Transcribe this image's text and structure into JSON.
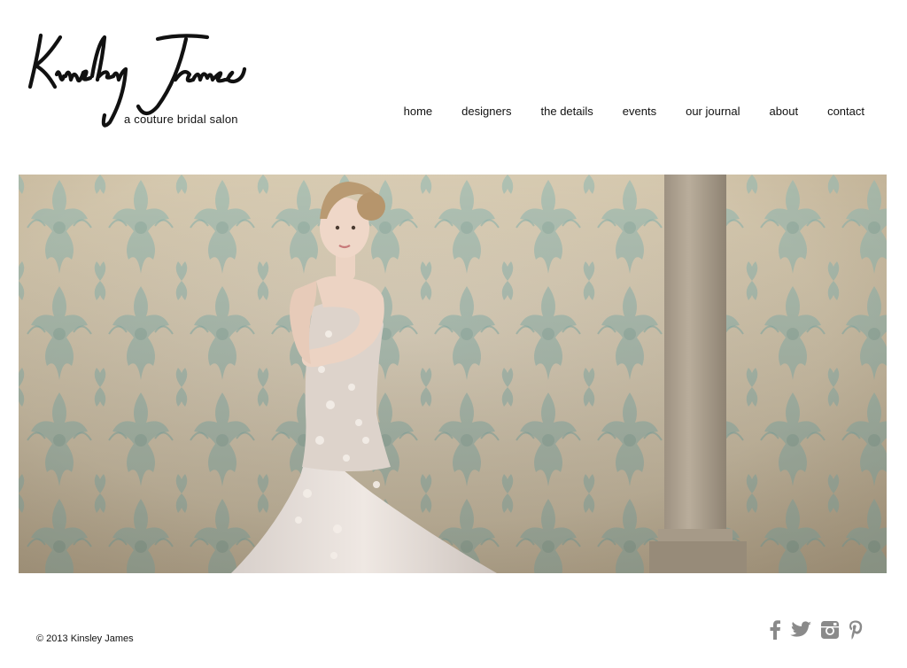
{
  "brand": {
    "tagline": "a couture bridal salon"
  },
  "nav": {
    "items": [
      {
        "label": "home"
      },
      {
        "label": "designers"
      },
      {
        "label": "the details"
      },
      {
        "label": "events"
      },
      {
        "label": "our journal"
      },
      {
        "label": "about"
      },
      {
        "label": "contact"
      }
    ]
  },
  "hero": {
    "image": "bride-in-embellished-gown-against-damask-wall-photo"
  },
  "footer": {
    "copyright": "© 2013 Kinsley James",
    "social": [
      "facebook-icon",
      "twitter-icon",
      "instagram-icon",
      "pinterest-icon"
    ]
  },
  "colors": {
    "text": "#111111",
    "social_icon": "#8a8a8a",
    "wall": "#d9cdb7",
    "damask": "#8fb8b4"
  }
}
